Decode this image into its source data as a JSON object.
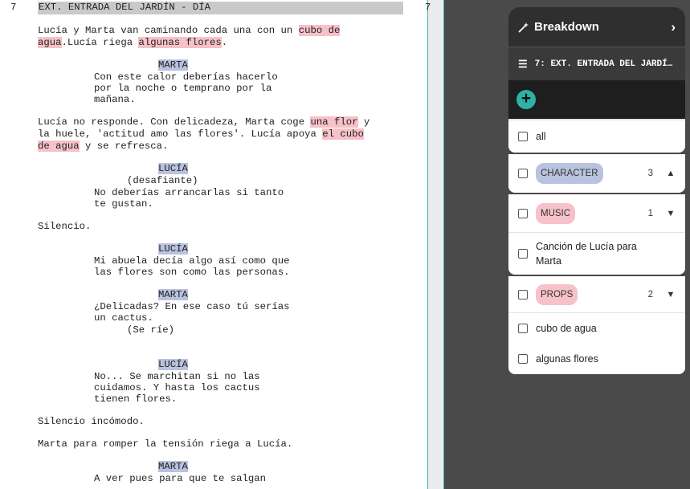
{
  "script": {
    "scene_number": "7",
    "scene_heading": "EXT. ENTRADA DEL JARDÍN - DÍA",
    "lines": {
      "l1a": "Lucía y Marta van caminando cada una con un ",
      "l1b": "cubo de",
      "l2a": "agua",
      "l2b": ".Lucía riega ",
      "l2c": "algunas flores",
      "l2d": ".",
      "c1": "MARTA",
      "d1": "Con este calor deberías hacerlo",
      "d2": "por la noche o temprano por la",
      "d3": "mañana.",
      "a1a": "Lucía no responde. Con delicadeza, Marta coge ",
      "a1b": "una flor",
      "a1c": " y",
      "a2a": "la huele, 'actitud amo las flores'. Lucía apoya ",
      "a2b": "el cubo",
      "a3a": "de agua",
      "a3b": " y se refresca.",
      "c2": "LUCÍA",
      "p1": "(desafiante)",
      "d4": "No deberías arrancarlas si tanto",
      "d5": "te gustan.",
      "s1": "Silencio.",
      "c3": "LUCÍA",
      "d6": "Mi abuela decía algo así como que",
      "d7": "las flores son como las personas.",
      "c4": "MARTA",
      "d8": "¿Delicadas? En ese caso tú serías",
      "d9": "un cactus.",
      "p2": "(Se ríe)",
      "c5": "LUCÍA",
      "d10": "No... Se marchitan si no las",
      "d11": "cuidamos. Y hasta los cactus",
      "d12": "tienen flores.",
      "s2": "Silencio incómodo.",
      "s3": "Marta para romper la tensión riega a Lucía.",
      "c6": "MARTA",
      "d13": "A ver pues para que te salgan"
    }
  },
  "breakdown": {
    "title": "Breakdown",
    "scene_label": "7: EXT. ENTRADA DEL JARDÍ…",
    "add_label": "+",
    "all_label": "all",
    "categories": [
      {
        "name": "CHARACTER",
        "count": "3",
        "caret": "⌃",
        "color": "#b9c2df"
      },
      {
        "name": "MUSIC",
        "count": "1",
        "caret": "⌄",
        "color": "#f6c1c8"
      },
      {
        "name": "PROPS",
        "count": "2",
        "caret": "⌄",
        "color": "#f6c1c8"
      }
    ],
    "music_items": [
      "Canción de Lucía para Marta"
    ],
    "props_items": [
      "cubo de agua",
      "algunas flores"
    ]
  }
}
